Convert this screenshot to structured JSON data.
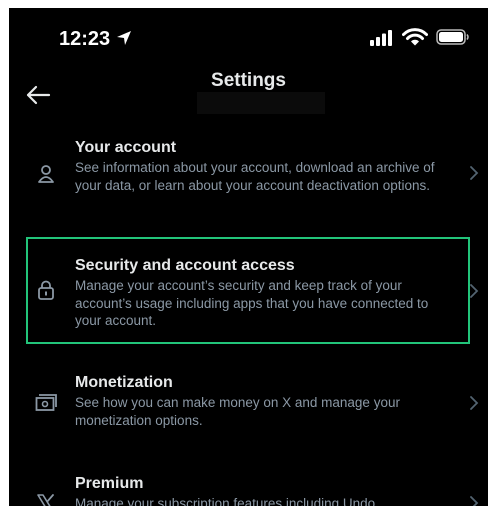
{
  "status_bar": {
    "time": "12:23"
  },
  "header": {
    "title": "Settings",
    "back_icon": "arrow-left-icon"
  },
  "settings_items": [
    {
      "title": "Your account",
      "description": "See information about your account, download an archive of your data, or learn about your account deactivation options.",
      "icon": "person-icon"
    },
    {
      "title": "Security and account access",
      "description": "Manage your account’s security and keep track of your account’s usage including apps that you have connected to your account.",
      "icon": "lock-icon",
      "highlighted": true
    },
    {
      "title": "Monetization",
      "description": "See how you can make money on X and manage your monetization options.",
      "icon": "money-icon"
    },
    {
      "title": "Premium",
      "description": "Manage your subscription features including Undo",
      "icon": "x-logo-icon"
    }
  ],
  "colors": {
    "background": "#000000",
    "text_primary": "#e7e9ea",
    "text_secondary": "#8b98a5",
    "highlight": "#22c47a"
  }
}
